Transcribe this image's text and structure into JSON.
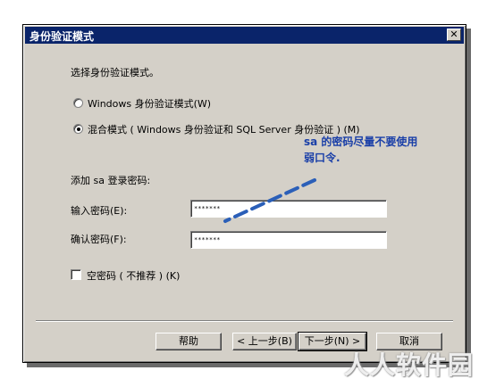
{
  "dialog": {
    "title": "身份验证模式",
    "close_glyph": "✕",
    "prompt": "选择身份验证模式。",
    "options": [
      {
        "label": "Windows 身份验证模式(W)",
        "selected": false
      },
      {
        "label": "混合模式 ( Windows 身份验证和 SQL Server 身份验证 ) (M)",
        "selected": true
      }
    ],
    "sa_section_label": "添加 sa 登录密码:",
    "password": {
      "label": "输入密码(E):",
      "value": "*******"
    },
    "confirm": {
      "label": "确认密码(F):",
      "value": "*******"
    },
    "blank_password": {
      "label": "空密码 ( 不推荐 ) (K)",
      "checked": false
    },
    "buttons": {
      "help": "帮助",
      "back": "< 上一步(B)",
      "next": "下一步(N) >",
      "cancel": "取消"
    }
  },
  "annotation": {
    "line1": "sa 的密码尽量不要使用",
    "line2": "弱口令.",
    "color": "#1a3fa8"
  },
  "watermark": "人人软件园",
  "colors": {
    "titlebar": "#0a246a",
    "dialog_bg": "#d4d0c8"
  }
}
